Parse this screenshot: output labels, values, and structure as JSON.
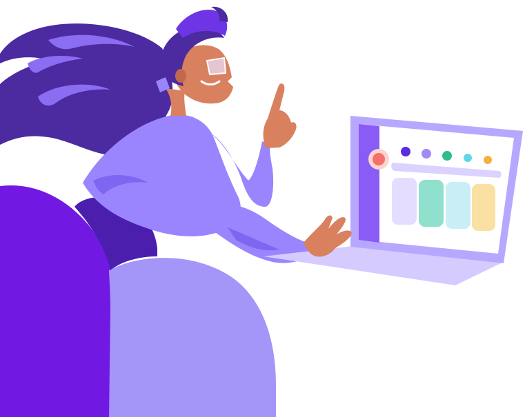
{
  "illustration": {
    "colors": {
      "background": "#ffffff",
      "hair": "#4c2a9f",
      "hair_highlight": "#8b6df2",
      "skin": "#d9805f",
      "skin_shadow": "#c1694b",
      "sweater": "#9a85ff",
      "sweater_shadow": "#7f66f0",
      "pants": "#4b1eae",
      "cap": "#6d35e6",
      "blob_dark": "#7119e3",
      "blob_light": "#a495f8",
      "laptop_frame": "#b8a7ff",
      "laptop_base": "#d5cbff",
      "screen_sidebar": "#8a5cf5",
      "screen_bg": "#ffffff"
    },
    "screen": {
      "dots": [
        "#5b2be0",
        "#a48af5",
        "#2fbd8f",
        "#5fd7e8",
        "#f3b13d"
      ],
      "avatar_color": "#f5706a",
      "search_bar_color": "#dcd2ff",
      "cards": [
        "#e4ddff",
        "#8fe0cc",
        "#c9eef5",
        "#fbe0a3"
      ]
    }
  }
}
